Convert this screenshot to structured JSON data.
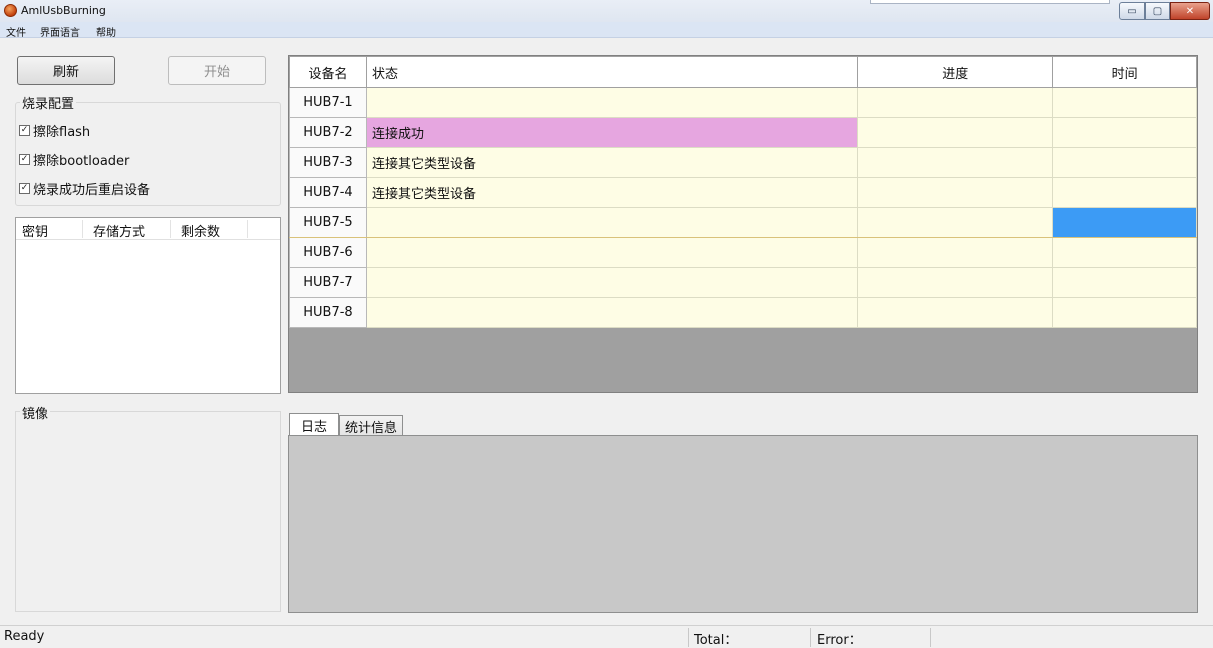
{
  "window": {
    "title": "AmlUsbBurning",
    "buttons": {
      "minimize": "▭",
      "maximize": "▢",
      "close": "✕"
    }
  },
  "menu": {
    "items": [
      "文件",
      "界面语言",
      "帮助"
    ]
  },
  "left": {
    "refresh_label": "刷新",
    "start_label": "开始",
    "burn_config": {
      "title": "烧录配置",
      "options": [
        {
          "label": "擦除flash",
          "checked": true
        },
        {
          "label": "擦除bootloader",
          "checked": true
        },
        {
          "label": "烧录成功后重启设备",
          "checked": true
        }
      ]
    },
    "key_table": {
      "headers": [
        "密钥",
        "存储方式",
        "剩余数"
      ]
    },
    "mirror_label": "镜像"
  },
  "device_grid": {
    "headers": [
      "设备名",
      "状态",
      "进度",
      "时间"
    ],
    "rows": [
      {
        "name": "HUB7-1",
        "status": "",
        "progress": "",
        "time": ""
      },
      {
        "name": "HUB7-2",
        "status": "连接成功",
        "progress": "",
        "time": "",
        "status_color": "#e6a6e0"
      },
      {
        "name": "HUB7-3",
        "status": "连接其它类型设备",
        "progress": "",
        "time": ""
      },
      {
        "name": "HUB7-4",
        "status": "连接其它类型设备",
        "progress": "",
        "time": ""
      },
      {
        "name": "HUB7-5",
        "status": "",
        "progress": "",
        "time": "",
        "selected": true,
        "time_color": "#3c9bf5"
      },
      {
        "name": "HUB7-6",
        "status": "",
        "progress": "",
        "time": ""
      },
      {
        "name": "HUB7-7",
        "status": "",
        "progress": "",
        "time": ""
      },
      {
        "name": "HUB7-8",
        "status": "",
        "progress": "",
        "time": ""
      }
    ]
  },
  "log_tabs": {
    "log_label": "日志",
    "stats_label": "统计信息"
  },
  "statusbar": {
    "ready": "Ready",
    "total_label": "Total：",
    "error_label": "Error："
  },
  "colors": {
    "row_bg": "#fefde5",
    "success": "#e6a6e0",
    "selection": "#3c9bf5",
    "empty_grid": "#a0a0a0"
  }
}
